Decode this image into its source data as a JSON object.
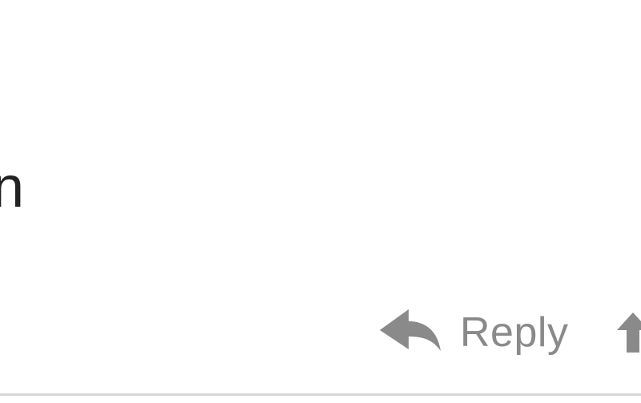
{
  "message": {
    "body_fragment": "n"
  },
  "actions": {
    "reply_label": "Reply",
    "reply_icon": "reply-arrow-icon",
    "next_icon": "reply-all-icon",
    "icon_color": "#8a8a8a"
  }
}
